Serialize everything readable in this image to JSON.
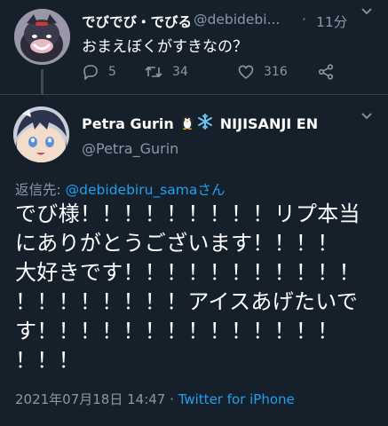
{
  "parent_tweet": {
    "display_name": "でびでび・でびる",
    "handle": "@debidebi...",
    "separator": "·",
    "time": "11分",
    "text": "おまえぼくがすきなの？",
    "more_icon": "more-icon",
    "reply_count": "5",
    "retweet_count": "34",
    "like_count": "316"
  },
  "main_tweet": {
    "display_name": "Petra Gurin",
    "name_suffix": "NIJISANJI EN",
    "name_emojis": [
      "penguin-emoji",
      "snowflake-emoji"
    ],
    "handle": "@Petra_Gurin",
    "replying_label": "返信先:",
    "replying_mention": "@debidebiru_samaさん",
    "text_lines": [
      "でび様！！！！！！！！！リプ本当",
      "にありがとうございます！！！！",
      "大好きです！！！！！！！！！！！",
      "！！！！！！！！アイスあげたいで",
      "す！！！！！！！！！！！！！！",
      "！！！"
    ],
    "date": "2021年07月18日 14:47",
    "meta_separator": "·",
    "source": "Twitter for iPhone"
  },
  "colors": {
    "background": "#15202b",
    "text": "#ffffff",
    "muted": "#8899a6",
    "accent": "#1da1f2",
    "divider": "#38444d"
  }
}
